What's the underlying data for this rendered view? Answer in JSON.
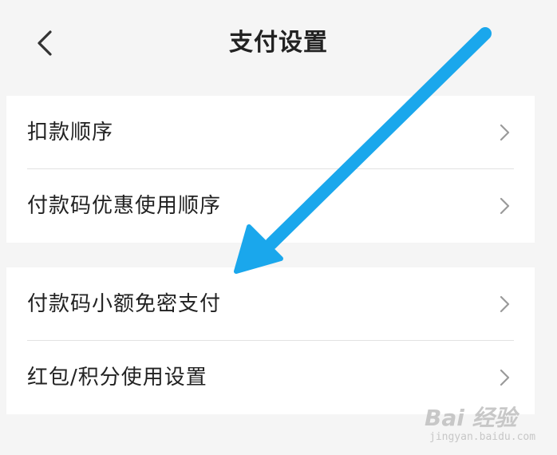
{
  "header": {
    "title": "支付设置",
    "back_icon": "chevron-left-icon"
  },
  "groups": [
    {
      "items": [
        {
          "label": "扣款顺序",
          "icon": "chevron-right-icon"
        },
        {
          "label": "付款码优惠使用顺序",
          "icon": "chevron-right-icon"
        }
      ]
    },
    {
      "items": [
        {
          "label": "付款码小额免密支付",
          "icon": "chevron-right-icon"
        },
        {
          "label": "红包/积分使用设置",
          "icon": "chevron-right-icon"
        }
      ]
    }
  ],
  "annotation": {
    "arrow_color": "#1aa7ec"
  },
  "watermark": {
    "main": "Bai 经验",
    "sub": "jingyan.baidu.com"
  },
  "colors": {
    "background": "#f5f5f5",
    "card": "#ffffff",
    "text": "#222222",
    "chevron": "#9a9a9a",
    "divider": "#e2e2e2"
  }
}
